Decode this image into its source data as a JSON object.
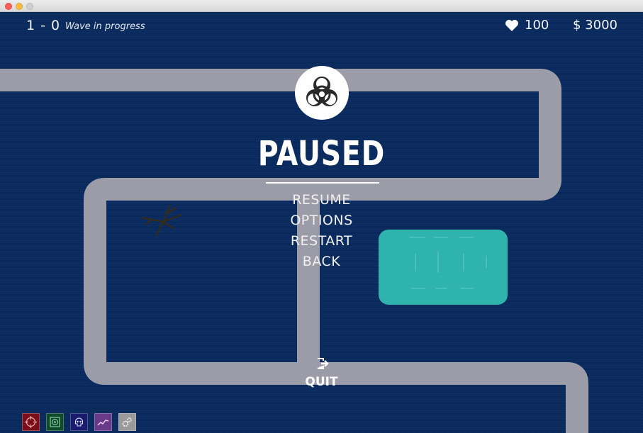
{
  "window": {
    "traffic_lights": [
      "close",
      "minimize",
      "zoom"
    ]
  },
  "hud": {
    "score": "1 - 0",
    "wave_status": "Wave in progress",
    "lives": "100",
    "money": "$ 3000"
  },
  "pause_menu": {
    "logo_icon": "biohazard-icon",
    "title": "PAUSED",
    "items": [
      "RESUME",
      "OPTIONS",
      "RESTART",
      "BACK"
    ]
  },
  "quit": {
    "icon": "exit-icon",
    "label": "QUIT"
  },
  "towers": [
    {
      "icon": "crosshair-icon",
      "color": "#7a0f1a"
    },
    {
      "icon": "radar-icon",
      "color": "#0f4a2a"
    },
    {
      "icon": "skull-icon",
      "color": "#1a1a6e"
    },
    {
      "icon": "trend-icon",
      "color": "#6a3a8a"
    },
    {
      "icon": "gears-icon",
      "color": "#9a9a9a"
    }
  ],
  "colors": {
    "background": "#0b2a5c",
    "path": "#9a9aa6",
    "pool": "#2fb3ad",
    "text": "#ffffff"
  }
}
